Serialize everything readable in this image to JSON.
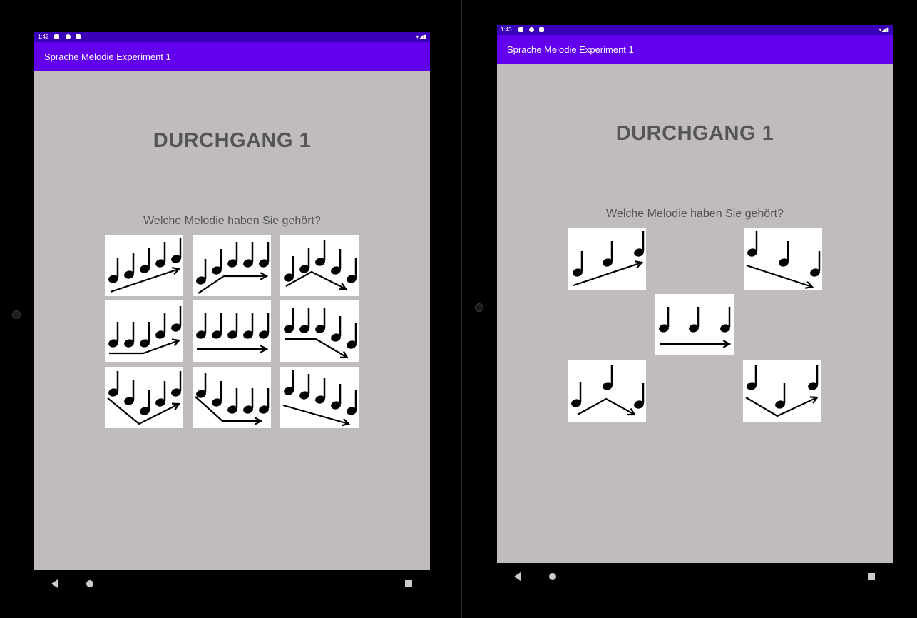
{
  "colors": {
    "statusbar": "#3a00b8",
    "appbar": "#6200ee",
    "content_bg": "#c1bcbc",
    "text": "#555555"
  },
  "left": {
    "status": {
      "time": "1:42"
    },
    "app_title": "Sprache Melodie Experiment 1",
    "heading": "DURCHGANG 1",
    "question": "Welche Melodie haben Sie gehört?",
    "options": [
      "rising-5-notes",
      "rising-then-flat",
      "rise-fall",
      "flat-then-rising",
      "flat-5-notes",
      "flat-then-falling",
      "fall-rise",
      "falling-then-flat",
      "falling-5-notes"
    ]
  },
  "right": {
    "status": {
      "time": "1:43"
    },
    "app_title": "Sprache Melodie Experiment 1",
    "heading": "DURCHGANG 1",
    "question": "Welche Melodie haben Sie gehört?",
    "options": [
      "rising-3-notes",
      "falling-3-notes",
      "flat-3-notes",
      "rise-fall-3-notes",
      "fall-rise-3-notes"
    ]
  },
  "nav_icons": [
    "back-icon",
    "home-icon",
    "recents-icon"
  ]
}
